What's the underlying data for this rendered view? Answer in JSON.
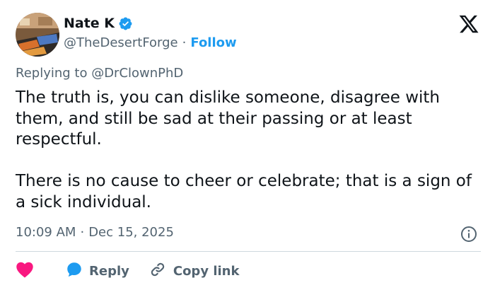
{
  "author": {
    "name": "Nate K",
    "handle": "@TheDesertForge",
    "separator": "·",
    "follow_label": "Follow"
  },
  "reply_context": "Replying to @DrClownPhD",
  "tweet": {
    "paragraphs": [
      "The truth is, you can dislike someone, disagree with them, and still be sad at their passing or at least respectful.",
      "There is no cause to cheer or celebrate; that is a sign of a sick individual."
    ]
  },
  "meta": {
    "time": "10:09 AM",
    "separator": "·",
    "date": "Dec 15, 2025"
  },
  "actions": {
    "reply_label": "Reply",
    "copy_link_label": "Copy link"
  },
  "icons": {
    "verified": "verified-badge-icon",
    "logo": "x-logo-icon",
    "info": "info-icon",
    "like": "heart-icon",
    "reply": "reply-bubble-icon",
    "link": "link-icon"
  },
  "colors": {
    "accent": "#1d9bf0",
    "like": "#f91880",
    "text": "#0f1419",
    "secondary": "#536471",
    "divider": "#cfd9de"
  }
}
